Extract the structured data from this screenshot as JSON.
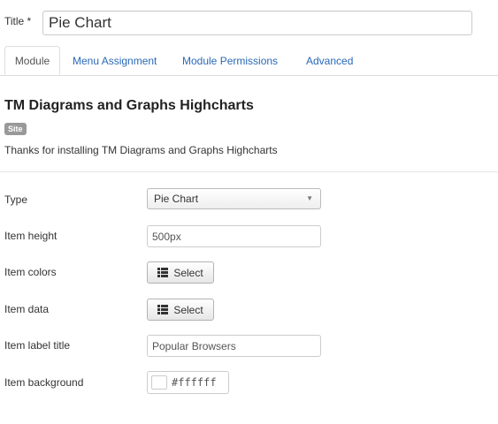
{
  "title_field": {
    "label": "Title *",
    "value": "Pie Chart"
  },
  "tabs": [
    {
      "label": "Module",
      "active": true
    },
    {
      "label": "Menu Assignment",
      "active": false
    },
    {
      "label": "Module Permissions",
      "active": false
    },
    {
      "label": "Advanced",
      "active": false
    }
  ],
  "module": {
    "name": "TM Diagrams and Graphs Highcharts",
    "badge": "Site",
    "description": "Thanks for installing TM Diagrams and Graphs Highcharts"
  },
  "form": {
    "type": {
      "label": "Type",
      "value": "Pie Chart"
    },
    "item_height": {
      "label": "Item height",
      "value": "500px"
    },
    "item_colors": {
      "label": "Item colors",
      "button": "Select",
      "icon": "list-icon"
    },
    "item_data": {
      "label": "Item data",
      "button": "Select",
      "icon": "list-icon"
    },
    "item_label_title": {
      "label": "Item label title",
      "value": "Popular Browsers"
    },
    "item_background": {
      "label": "Item background",
      "value": "#ffffff",
      "swatch_color": "#ffffff"
    }
  },
  "colors": {
    "link": "#2a69b8",
    "badge_bg": "#999999"
  }
}
